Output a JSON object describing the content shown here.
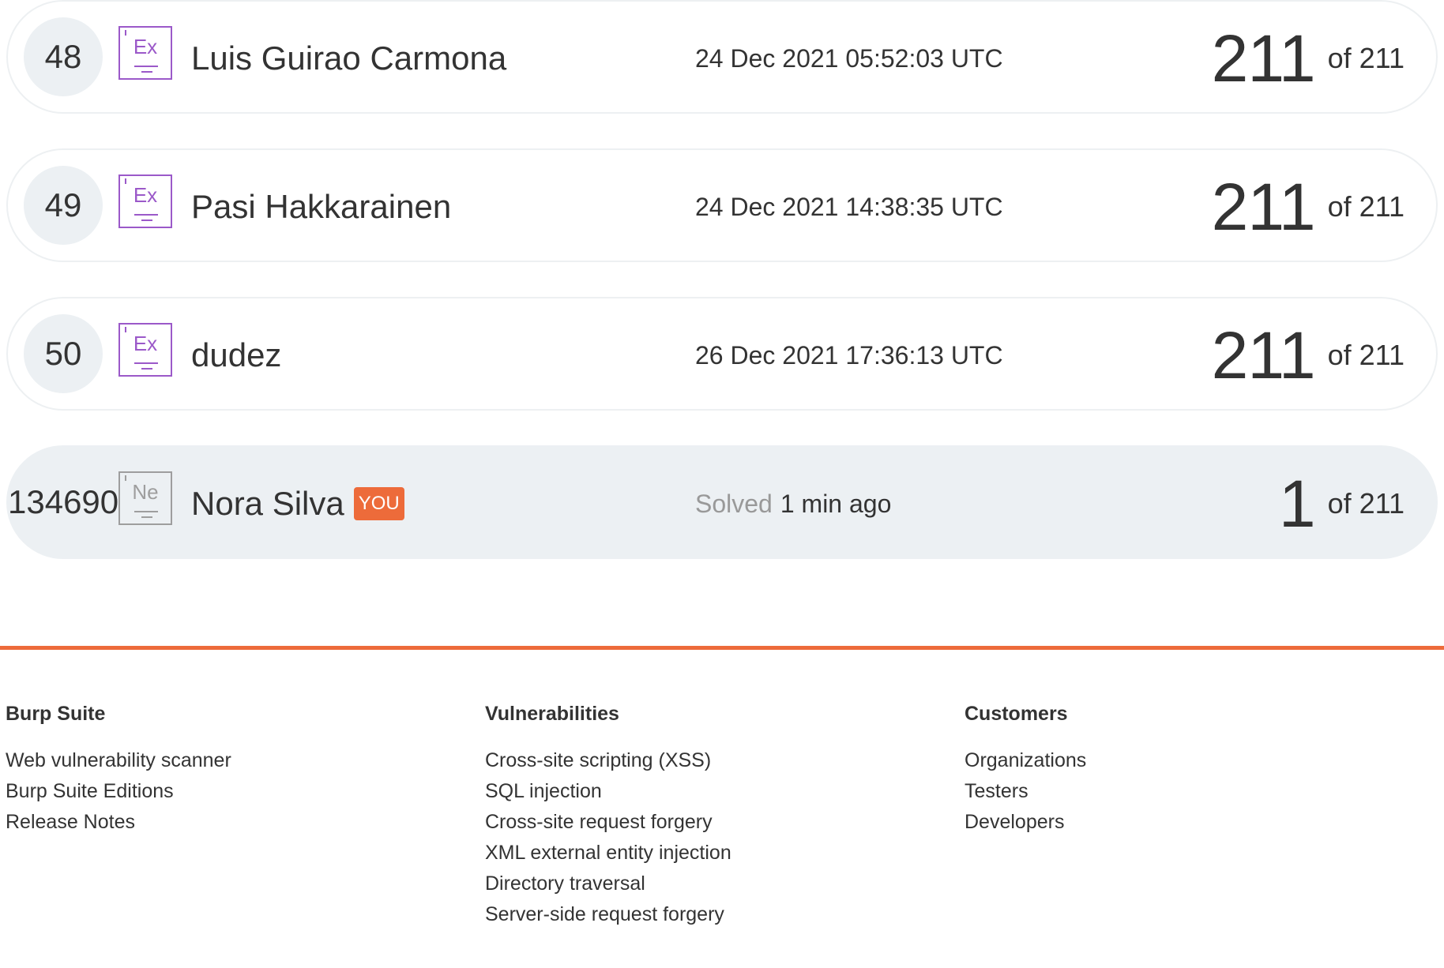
{
  "leaderboard": {
    "rows": [
      {
        "rank": "48",
        "level": "Ex",
        "name": "Luis Guirao Carmona",
        "date": "24 Dec 2021 05:52:03 UTC",
        "score": "211",
        "total": "of 211"
      },
      {
        "rank": "49",
        "level": "Ex",
        "name": "Pasi Hakkarainen",
        "date": "24 Dec 2021 14:38:35 UTC",
        "score": "211",
        "total": "of 211"
      },
      {
        "rank": "50",
        "level": "Ex",
        "name": "dudez",
        "date": "26 Dec 2021 17:36:13 UTC",
        "score": "211",
        "total": "of 211"
      }
    ],
    "current_user": {
      "rank": "134690",
      "level": "Ne",
      "name": "Nora Silva",
      "badge": "YOU",
      "solved_label": "Solved",
      "solved_time": "1 min ago",
      "score": "1",
      "total": "of 211"
    }
  },
  "footer": {
    "columns": [
      {
        "heading": "Burp Suite",
        "links": [
          "Web vulnerability scanner",
          "Burp Suite Editions",
          "Release Notes"
        ]
      },
      {
        "heading": "Vulnerabilities",
        "links": [
          "Cross-site scripting (XSS)",
          "SQL injection",
          "Cross-site request forgery",
          "XML external entity injection",
          "Directory traversal",
          "Server-side request forgery"
        ]
      },
      {
        "heading": "Customers",
        "links": [
          "Organizations",
          "Testers",
          "Developers"
        ]
      }
    ]
  },
  "colors": {
    "accent": "#ed6b3a",
    "expert_level": "#9b59c9",
    "novice_level": "#9e9e9e",
    "row_highlight": "#ecf0f3"
  }
}
